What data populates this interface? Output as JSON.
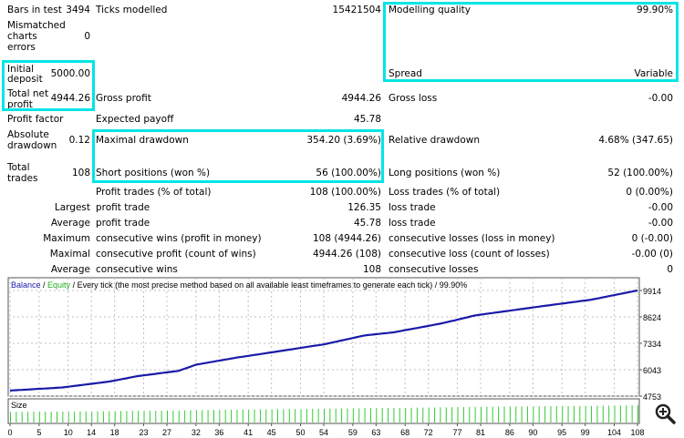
{
  "report": {
    "bars_in_test": {
      "label": "Bars in test",
      "value": "3494"
    },
    "ticks_modelled": {
      "label": "Ticks modelled",
      "value": "15421504"
    },
    "modelling_quality": {
      "label": "Modelling quality",
      "value": "99.90%"
    },
    "mismatched": {
      "label1": "Mismatched",
      "label2": "charts",
      "label3": "errors",
      "value": "0"
    },
    "initial_deposit": {
      "label1": "Initial",
      "label2": "deposit",
      "value": "5000.00"
    },
    "spread": {
      "label": "Spread",
      "value": "Variable"
    },
    "total_net_profit": {
      "label1": "Total net",
      "label2": "profit",
      "value": "4944.26"
    },
    "gross_profit": {
      "label": "Gross profit",
      "value": "4944.26"
    },
    "gross_loss": {
      "label": "Gross loss",
      "value": "-0.00"
    },
    "profit_factor": {
      "label": "Profit factor"
    },
    "expected_payoff": {
      "label": "Expected payoff",
      "value": "45.78"
    },
    "absolute_drawdown": {
      "label1": "Absolute",
      "label2": "drawdown",
      "value": "0.12"
    },
    "maximal_drawdown": {
      "label": "Maximal drawdown",
      "value": "354.20 (3.69%)"
    },
    "relative_drawdown": {
      "label": "Relative drawdown",
      "value": "4.68% (347.65)"
    },
    "total_trades": {
      "label1": "Total",
      "label2": "trades",
      "value": "108"
    },
    "short_positions": {
      "label": "Short positions (won %)",
      "value": "56 (100.00%)"
    },
    "long_positions": {
      "label": "Long positions (won %)",
      "value": "52 (100.00%)"
    },
    "rows": [
      {
        "pre": "",
        "l1": "Profit trades (% of total)",
        "v1": "108 (100.00%)",
        "l2": "Loss trades (% of total)",
        "v2": "0 (0.00%)"
      },
      {
        "pre": "Largest",
        "l1": "profit trade",
        "v1": "126.35",
        "l2": "loss trade",
        "v2": "-0.00"
      },
      {
        "pre": "Average",
        "l1": "profit trade",
        "v1": "45.78",
        "l2": "loss trade",
        "v2": "-0.00"
      },
      {
        "pre": "Maximum",
        "l1": "consecutive wins (profit in money)",
        "v1": "108 (4944.26)",
        "l2": "consecutive losses (loss in money)",
        "v2": "0 (-0.00)"
      },
      {
        "pre": "Maximal",
        "l1": "consecutive profit (count of wins)",
        "v1": "4944.26 (108)",
        "l2": "consecutive loss (count of losses)",
        "v2": "-0.00 (0)"
      },
      {
        "pre": "Average",
        "l1": "consecutive wins",
        "v1": "108",
        "l2": "consecutive losses",
        "v2": "0"
      }
    ]
  },
  "chart_data": {
    "type": "line",
    "legend": {
      "balance": "Balance",
      "sep": " / ",
      "equity": "Equity",
      "rest": " / Every tick (the most precise method based on all available least timeframes to generate each tick) / 99.90%"
    },
    "size_label": "Size",
    "y_ticks": [
      "9914",
      "8624",
      "7334",
      "6043",
      "4753"
    ],
    "ylim": [
      4753,
      9914
    ],
    "xlim": [
      0,
      108
    ],
    "x_ticks": [
      "0",
      "5",
      "10",
      "14",
      "18",
      "23",
      "27",
      "32",
      "36",
      "41",
      "45",
      "50",
      "54",
      "59",
      "63",
      "68",
      "72",
      "77",
      "81",
      "86",
      "90",
      "95",
      "99",
      "104",
      "108"
    ],
    "balance": {
      "x": [
        0,
        9,
        17,
        22,
        29,
        32,
        39,
        45,
        54,
        61,
        66,
        74,
        77,
        80,
        92,
        100,
        108
      ],
      "y": [
        5024,
        5174,
        5460,
        5731,
        5987,
        6288,
        6634,
        6890,
        7281,
        7717,
        7868,
        8289,
        8485,
        8695,
        9162,
        9462,
        9914
      ]
    },
    "colors": {
      "balance": "#1a1aa8",
      "equity": "#22aa22",
      "size": "#33cc33",
      "grid": "#c0c0c0",
      "highlight": "#00e5e5"
    }
  }
}
